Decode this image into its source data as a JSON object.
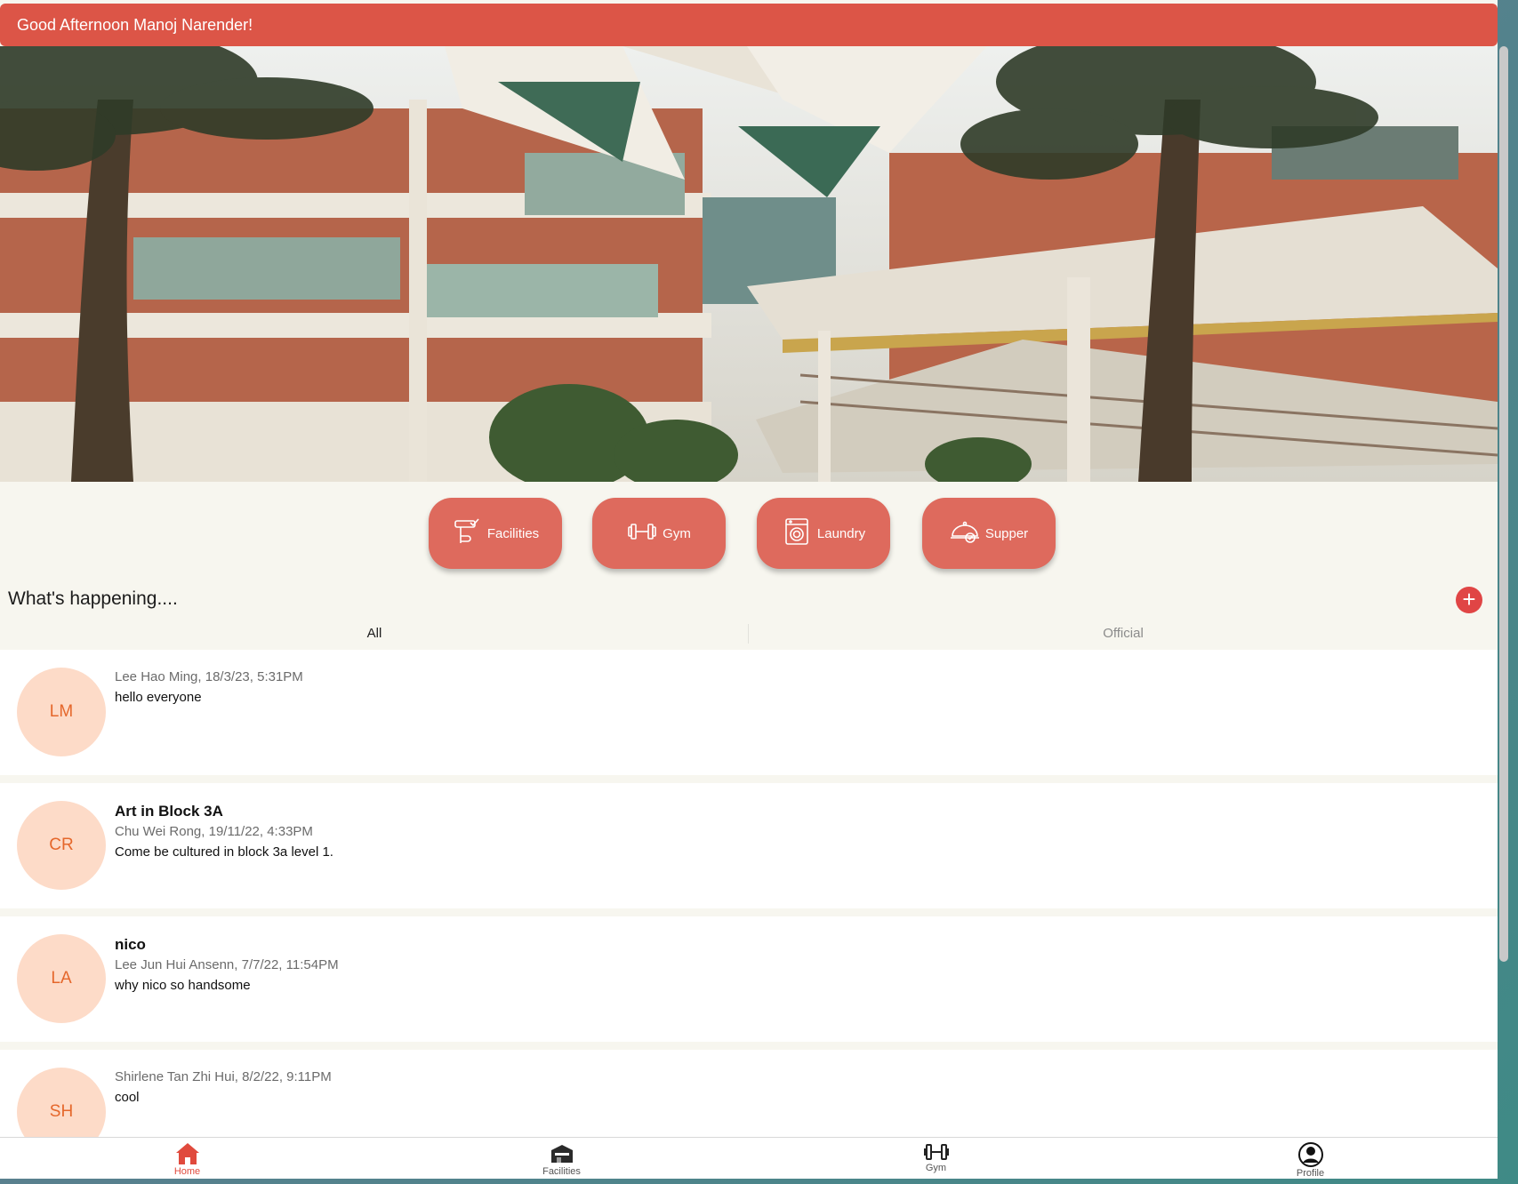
{
  "header": {
    "greeting": "Good Afternoon Manoj Narender!"
  },
  "hero": {
    "icon": "building-photo"
  },
  "shortcuts": [
    {
      "label": "Facilities",
      "icon": "facilities-icon"
    },
    {
      "label": "Gym",
      "icon": "dumbbell-icon"
    },
    {
      "label": "Laundry",
      "icon": "washing-machine-icon"
    },
    {
      "label": "Supper",
      "icon": "cloche-icon"
    }
  ],
  "feed": {
    "title": "What's happening....",
    "add_label": "+",
    "tabs": [
      {
        "label": "All"
      },
      {
        "label": "Official"
      }
    ],
    "active_tab": "All",
    "posts": [
      {
        "initials": "LM",
        "title": "",
        "meta": "Lee Hao Ming, 18/3/23, 5:31PM",
        "text": "hello everyone"
      },
      {
        "initials": "CR",
        "title": "Art in Block 3A",
        "meta": "Chu Wei Rong, 19/11/22, 4:33PM",
        "text": "Come be cultured in block 3a level 1."
      },
      {
        "initials": "LA",
        "title": "nico",
        "meta": "Lee Jun Hui Ansenn, 7/7/22, 11:54PM",
        "text": "why nico so handsome"
      },
      {
        "initials": "SH",
        "title": "",
        "meta": "Shirlene Tan Zhi Hui, 8/2/22, 9:11PM",
        "text": "cool"
      }
    ]
  },
  "bottom_nav": [
    {
      "label": "Home",
      "icon": "home-icon",
      "active": true
    },
    {
      "label": "Facilities",
      "icon": "facilities-building-icon",
      "active": false
    },
    {
      "label": "Gym",
      "icon": "dumbbell-icon",
      "active": false
    },
    {
      "label": "Profile",
      "icon": "user-circle-icon",
      "active": false
    }
  ],
  "colors": {
    "accent": "#dc5547",
    "button": "#de6a5d",
    "avatar_bg": "#fddbc8",
    "avatar_text": "#e5672b",
    "background": "#f7f6ef"
  }
}
